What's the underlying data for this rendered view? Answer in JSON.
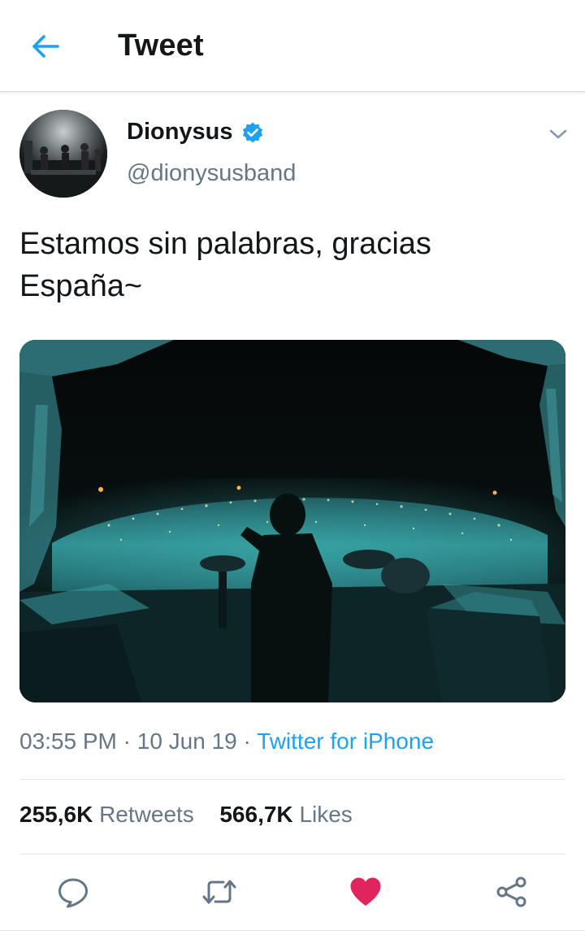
{
  "header": {
    "title": "Tweet",
    "back_icon": "arrow-left-icon"
  },
  "author": {
    "display_name": "Dionysus",
    "handle": "@dionysusband",
    "verified_icon": "verified-badge-icon"
  },
  "tweet": {
    "text_line1": "Estamos sin palabras, gracias",
    "text_line2": "España~",
    "time": "03:55 PM",
    "separator": "·",
    "date": "10 Jun 19",
    "source": "Twitter for iPhone"
  },
  "stats": {
    "retweets_count": "255,6K",
    "retweets_label": "Retweets",
    "likes_count": "566,7K",
    "likes_label": "Likes"
  },
  "actions": [
    {
      "name": "reply",
      "icon": "reply-icon"
    },
    {
      "name": "retweet",
      "icon": "retweet-icon"
    },
    {
      "name": "like",
      "icon": "heart-icon",
      "active": true
    },
    {
      "name": "share",
      "icon": "share-icon"
    }
  ],
  "colors": {
    "accent": "#1da1f2",
    "like_active": "#e0245e",
    "secondary_text": "#657786",
    "primary_text": "#14171a"
  }
}
